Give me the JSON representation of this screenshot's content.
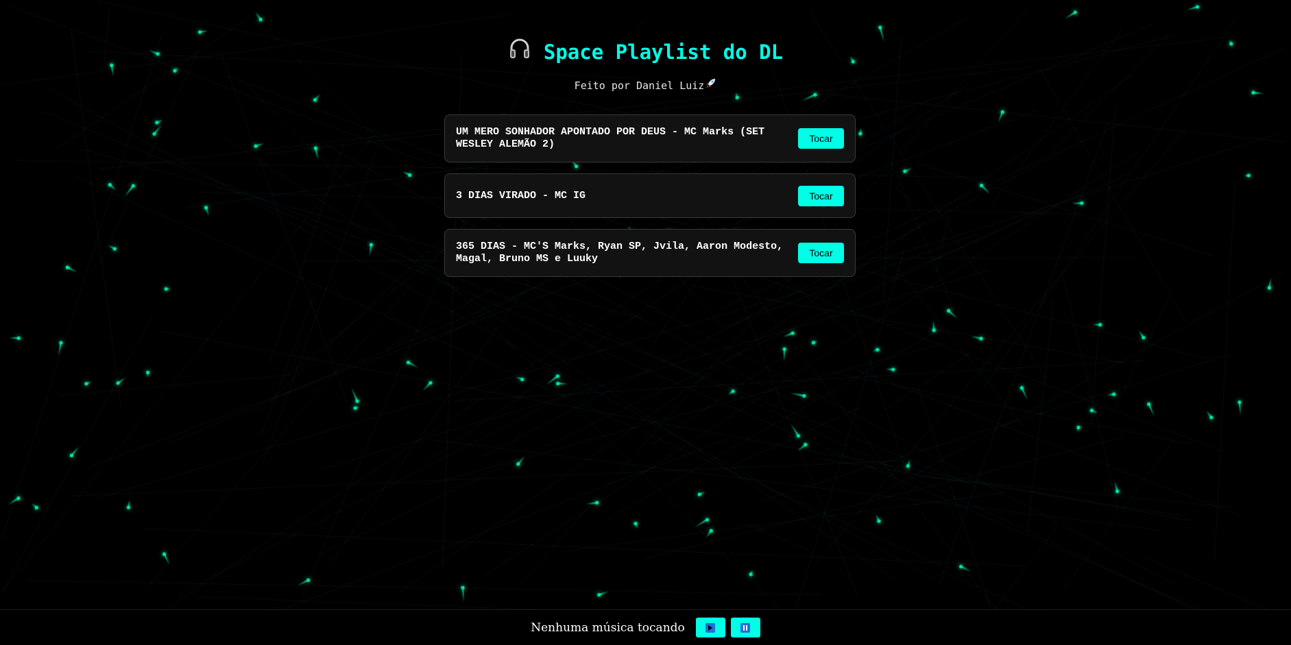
{
  "page": {
    "title": "Space Playlist do DL",
    "subtitle": "Feito por Daniel Luiz",
    "title_icon": "headphones-icon",
    "subtitle_icon": "rocket-icon"
  },
  "colors": {
    "accent": "#00ffe7",
    "background": "#000000",
    "card": "#121212",
    "star": "#00e6a8",
    "control_glyph_bg": "#1f6fd6"
  },
  "tracks": [
    {
      "name": "UM MERO SONHADOR APONTADO POR DEUS - MC Marks (SET WESLEY ALEMÃO 2)",
      "button": "Tocar"
    },
    {
      "name": "3 DIAS VIRADO - MC IG",
      "button": "Tocar"
    },
    {
      "name": "365 DIAS - MC'S Marks, Ryan SP, Jvila, Aaron Modesto, Magal, Bruno MS e Luuky",
      "button": "Tocar"
    }
  ],
  "player": {
    "status": "Nenhuma música tocando",
    "play_icon": "play-icon",
    "pause_icon": "pause-icon"
  }
}
